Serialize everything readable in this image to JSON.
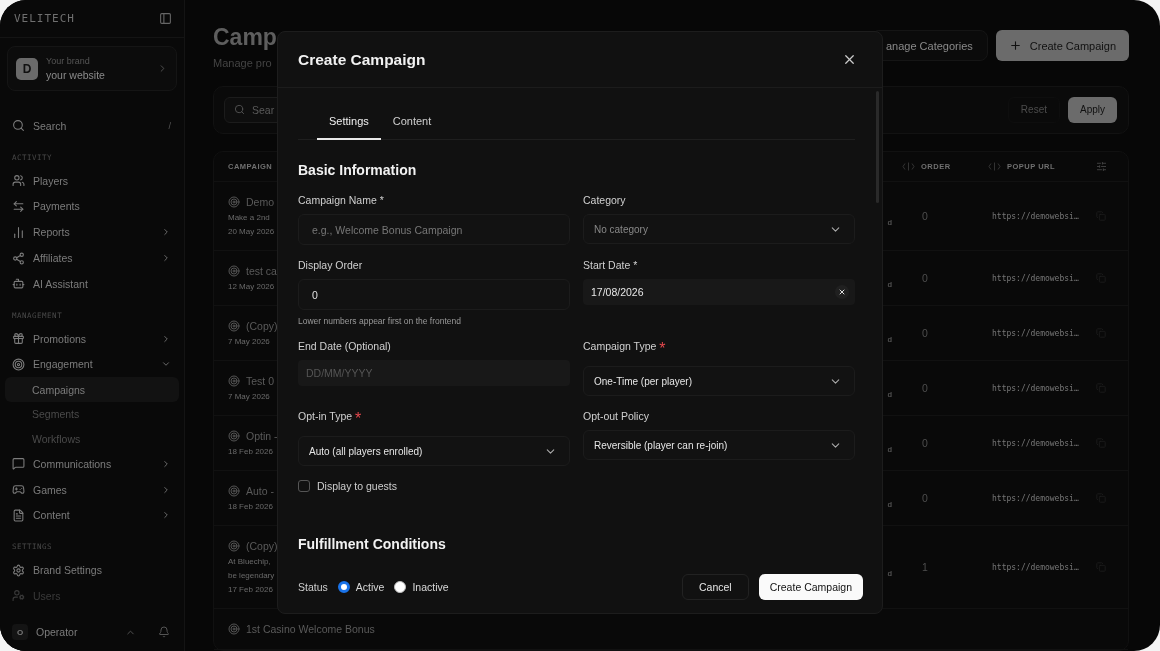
{
  "sidebar": {
    "logo": "VELITECH",
    "brand": {
      "avatar": "D",
      "label": "Your brand",
      "name": "your website"
    },
    "search": {
      "label": "Search",
      "shortcut": "/"
    },
    "sections": [
      {
        "title": "ACTIVITY",
        "items": [
          {
            "label": "Players"
          },
          {
            "label": "Payments"
          },
          {
            "label": "Reports",
            "expanded": false
          },
          {
            "label": "Affiliates",
            "expanded": false
          },
          {
            "label": "AI Assistant"
          }
        ]
      },
      {
        "title": "MANAGEMENT",
        "items": [
          {
            "label": "Promotions",
            "expanded": false
          },
          {
            "label": "Engagement",
            "expanded": true,
            "children": [
              {
                "label": "Campaigns",
                "selected": true
              },
              {
                "label": "Segments",
                "selected": false
              },
              {
                "label": "Workflows",
                "selected": false
              }
            ]
          },
          {
            "label": "Communications",
            "expanded": false
          },
          {
            "label": "Games",
            "expanded": false
          },
          {
            "label": "Content",
            "expanded": false
          }
        ]
      },
      {
        "title": "SETTINGS",
        "items": [
          {
            "label": "Brand Settings"
          },
          {
            "label": "Users"
          }
        ]
      }
    ],
    "user": {
      "avatar": "O",
      "name": "Operator"
    }
  },
  "header": {
    "title": "Camp",
    "subtitle": "Manage pro",
    "manage_button": "anage Categories",
    "create_button": "Create Campaign"
  },
  "filters": {
    "search_placeholder": "Sear",
    "reset": "Reset",
    "apply": "Apply"
  },
  "table": {
    "columns": [
      "CAMPAIGN",
      "ORDER",
      "POPUP URL"
    ],
    "rows": [
      {
        "name": "Demo",
        "description": [
          "Make a 2nd"
        ],
        "date": "20 May 2026",
        "status": "d",
        "order": "0",
        "popup_url": "https://demowebsi…"
      },
      {
        "name": "test ca",
        "date": "12 May 2026",
        "status": "d",
        "order": "0",
        "popup_url": "https://demowebsi…"
      },
      {
        "name": "(Copy)",
        "date": "7 May 2026",
        "status": "d",
        "order": "0",
        "popup_url": "https://demowebsi…"
      },
      {
        "name": "Test 0",
        "date": "7 May 2026",
        "status": "d",
        "order": "0",
        "popup_url": "https://demowebsi…"
      },
      {
        "name": "Optin -",
        "date": "18 Feb 2026",
        "status": "d",
        "order": "0",
        "popup_url": "https://demowebsi…"
      },
      {
        "name": "Auto -",
        "date": "18 Feb 2026",
        "status": "d",
        "order": "0",
        "popup_url": "https://demowebsi…"
      },
      {
        "name": "(Copy)",
        "description": [
          "At Bluechip,",
          "be legendary"
        ],
        "date": "17 Feb 2026",
        "status": "d",
        "order": "1",
        "popup_url": "https://demowebsi…"
      },
      {
        "name": "1st Casino Welcome Bonus"
      }
    ]
  },
  "modal": {
    "title": "Create Campaign",
    "tabs": [
      {
        "label": "Settings",
        "selected": true
      },
      {
        "label": "Content",
        "selected": false
      }
    ],
    "section": "Basic Information",
    "fields": [
      {
        "kind": "input",
        "label": "Campaign Name *",
        "placeholder": "e.g., Welcome Bonus Campaign"
      },
      {
        "kind": "select",
        "label": "Category",
        "placeholder": "No category"
      },
      {
        "kind": "input",
        "label": "Display Order",
        "value": "0",
        "hint": "Lower numbers appear first on the frontend"
      },
      {
        "kind": "date",
        "label": "Start Date *",
        "value": "17/08/2026",
        "clearable": true
      },
      {
        "kind": "date",
        "label": "End Date (Optional)",
        "placeholder": "DD/MM/YYYY"
      },
      {
        "kind": "select",
        "label": "Campaign Type",
        "required_mark": "*",
        "value": "One-Time (per player)"
      },
      {
        "kind": "select",
        "label": "Opt-in Type",
        "required_mark": "*",
        "value": "Auto (all players enrolled)"
      },
      {
        "kind": "select",
        "label": "Opt-out Policy",
        "value": "Reversible (player can re-join)"
      }
    ],
    "checkbox": {
      "label": "Display to guests",
      "checked": false
    },
    "section_2": "Fulfillment Conditions",
    "status": {
      "label": "Status",
      "options": [
        {
          "label": "Active",
          "selected": true
        },
        {
          "label": "Inactive",
          "selected": false
        }
      ]
    },
    "cancel": "Cancel",
    "submit": "Create Campaign"
  }
}
